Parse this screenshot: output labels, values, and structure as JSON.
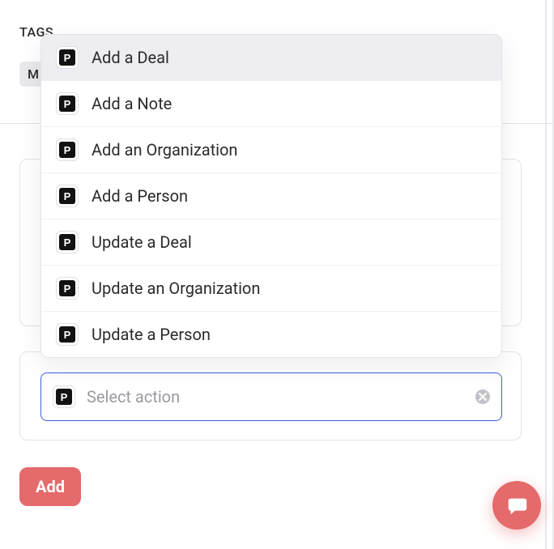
{
  "tags": {
    "label": "TAGS",
    "chip_visible_fragment": "M"
  },
  "dropdown": {
    "items": [
      {
        "label": "Add a Deal",
        "highlight": true
      },
      {
        "label": "Add a Note"
      },
      {
        "label": "Add an Organization"
      },
      {
        "label": "Add a Person"
      },
      {
        "label": "Update a Deal"
      },
      {
        "label": "Update an Organization"
      },
      {
        "label": "Update a Person"
      }
    ]
  },
  "select": {
    "placeholder": "Select action",
    "value": ""
  },
  "buttons": {
    "add": "Add"
  },
  "icons": {
    "p_glyph": "P"
  }
}
